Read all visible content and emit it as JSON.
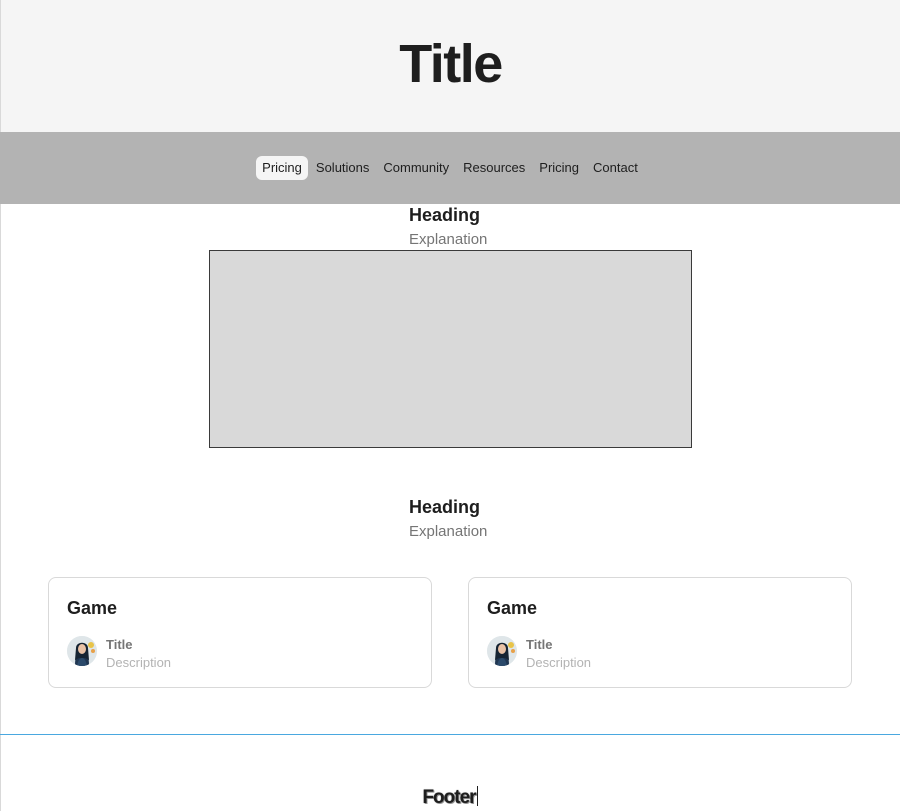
{
  "header": {
    "title": "Title"
  },
  "nav": {
    "items": [
      {
        "label": "Pricing",
        "active": true
      },
      {
        "label": "Solutions"
      },
      {
        "label": "Community"
      },
      {
        "label": "Resources"
      },
      {
        "label": "Pricing"
      },
      {
        "label": "Contact"
      }
    ]
  },
  "sections": [
    {
      "heading": "Heading",
      "explanation": "Explanation"
    },
    {
      "heading": "Heading",
      "explanation": "Explanation"
    }
  ],
  "cards": [
    {
      "title": "Game",
      "user_title": "Title",
      "user_description": "Description"
    },
    {
      "title": "Game",
      "user_title": "Title",
      "user_description": "Description"
    }
  ],
  "footer": {
    "text": "Footer"
  },
  "colors": {
    "header_bg": "#f5f5f5",
    "nav_bg": "#b3b3b3",
    "placeholder_bg": "#d9d9d9",
    "footer_divider": "#4aa8e0"
  }
}
